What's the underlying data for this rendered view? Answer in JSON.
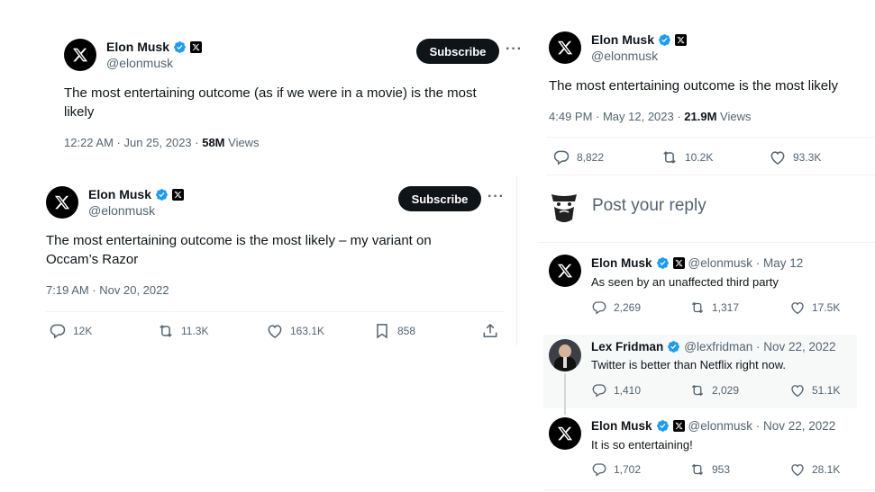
{
  "tweet_a": {
    "name": "Elon Musk",
    "handle": "@elonmusk",
    "subscribe": "Subscribe",
    "more": "···",
    "text": "The most entertaining outcome (as if we were in a movie) is the most likely",
    "time": "12:22 AM · Jun 25, 2023 · ",
    "views_count": "58M",
    "views_label": " Views"
  },
  "tweet_b": {
    "name": "Elon Musk",
    "handle": "@elonmusk",
    "subscribe": "Subscribe",
    "more": "···",
    "text": "The most entertaining outcome is the most likely – my variant on Occam’s Razor",
    "time": "7:19 AM · Nov 20, 2022",
    "replies": "12K",
    "retweets": "11.3K",
    "likes": "163.1K",
    "bookmarks": "858"
  },
  "tweet_c": {
    "name": "Elon Musk",
    "handle": "@elonmusk",
    "text": "The most entertaining outcome is the most likely",
    "time": "4:49 PM · May 12, 2023 · ",
    "views_count": "21.9M",
    "views_label": " Views",
    "replies": "8,822",
    "retweets": "10.2K",
    "likes": "93.3K"
  },
  "reply_box": {
    "placeholder": "Post your reply"
  },
  "replies": [
    {
      "name": "Elon Musk",
      "meta": "@elonmusk · May 12",
      "text": "As seen by an unaffected third party",
      "replies": "2,269",
      "retweets": "1,317",
      "likes": "17.5K"
    },
    {
      "name": "Lex Fridman",
      "meta": "@lexfridman · Nov 22, 2022",
      "text": "Twitter is better than Netflix right now.",
      "replies": "1,410",
      "retweets": "2,029",
      "likes": "51.1K"
    },
    {
      "name": "Elon Musk",
      "meta": "@elonmusk · Nov 22, 2022",
      "text": "It is so entertaining!",
      "replies": "1,702",
      "retweets": "953",
      "likes": "28.1K"
    }
  ],
  "colors": {
    "verified": "#1d9bf0",
    "text": "#0f1419",
    "secondary": "#536471",
    "divider": "#eff3f4",
    "highlight": "#f7f9f9"
  }
}
